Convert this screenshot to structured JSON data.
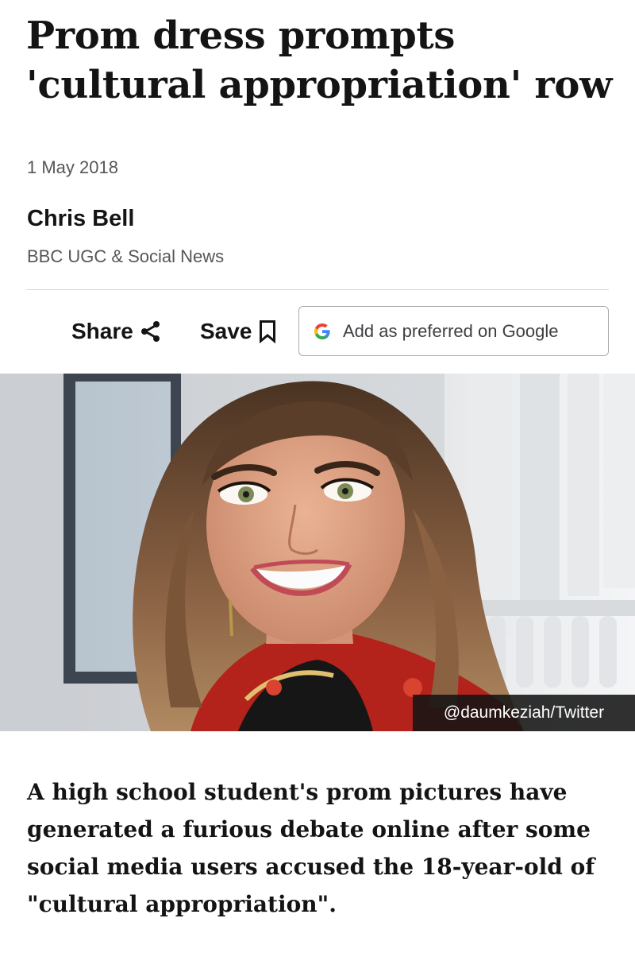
{
  "article": {
    "headline": "Prom dress prompts 'cultural appropriation' row",
    "date": "1 May 2018",
    "author_name": "Chris Bell",
    "author_role": "BBC UGC & Social News",
    "lede": "A high school student's prom pictures have generated a furious debate online after some social media users accused the 18-year-old of \"cultural appropriation\"."
  },
  "actions": {
    "share_label": "Share",
    "save_label": "Save",
    "google_label": "Add as preferred on Google",
    "share_icon": "share-icon",
    "save_icon": "bookmark-icon",
    "google_icon": "google-g-icon"
  },
  "image": {
    "credit": "@daumkeziah/Twitter"
  },
  "colors": {
    "text": "#141414",
    "muted": "#545658",
    "border": "#a7a9ab"
  }
}
